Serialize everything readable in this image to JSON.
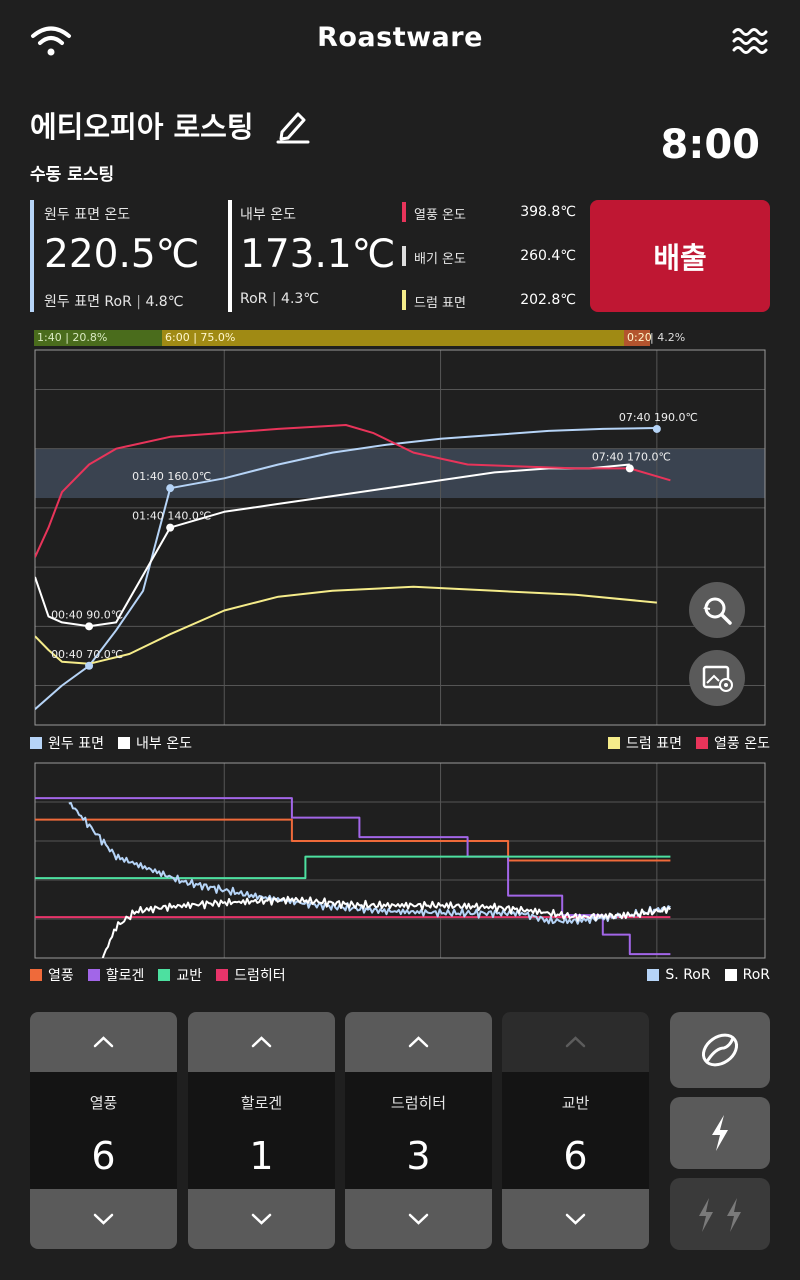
{
  "header": {
    "brand": "Roastware",
    "wifi_icon": "wifi-icon",
    "menu_icon": "wave-menu-icon"
  },
  "roast": {
    "title": "에티오피아 로스팅",
    "mode": "수동 로스팅",
    "elapsed": "8:00"
  },
  "stats": {
    "bean_surface": {
      "label": "원두 표면 온도",
      "value": "220.5℃",
      "ror_label": "원두 표면 RoR",
      "ror_value": "4.8℃"
    },
    "inner": {
      "label": "내부 온도",
      "value": "173.1℃",
      "ror_label": "RoR",
      "ror_value": "4.3℃"
    },
    "hot_air": {
      "label": "열풍 온도",
      "value": "398.8℃",
      "color": "#e8345a"
    },
    "exhaust": {
      "label": "배기 온도",
      "value": "260.4℃",
      "color": "#dddddd"
    },
    "drum": {
      "label": "드럼 표면",
      "value": "202.8℃",
      "color": "#f5ec8a"
    }
  },
  "discharge_button": "배출",
  "phases": [
    {
      "label": "1:40 | 20.8%",
      "fraction": 0.208,
      "color": "#4a6c1c"
    },
    {
      "label": "6:00 | 75.0%",
      "fraction": 0.75,
      "color": "#a08a14"
    },
    {
      "label": "0:20",
      "fraction": 0.042,
      "color": "#b3542e"
    }
  ],
  "phase_extra": "| 4.2%",
  "chart_data": [
    {
      "type": "line",
      "x_unit": "seconds",
      "xlim": [
        0,
        540
      ],
      "ylim": [
        40,
        230
      ],
      "band": [
        155,
        180
      ],
      "grid": true,
      "series": [
        {
          "name": "원두 표면",
          "color": "#b6d4f7",
          "points": [
            [
              0,
              48
            ],
            [
              20,
              60
            ],
            [
              40,
              70
            ],
            [
              60,
              88
            ],
            [
              80,
              108
            ],
            [
              100,
              160
            ],
            [
              140,
              165
            ],
            [
              180,
              172
            ],
            [
              220,
              178
            ],
            [
              260,
              182
            ],
            [
              300,
              185
            ],
            [
              340,
              187
            ],
            [
              380,
              189
            ],
            [
              420,
              190
            ],
            [
              460,
              190.5
            ]
          ]
        },
        {
          "name": "내부 온도",
          "color": "#ffffff",
          "points": [
            [
              0,
              115
            ],
            [
              10,
              95
            ],
            [
              20,
              92
            ],
            [
              40,
              90
            ],
            [
              60,
              92
            ],
            [
              100,
              140
            ],
            [
              140,
              148
            ],
            [
              180,
              152
            ],
            [
              220,
              156
            ],
            [
              260,
              160
            ],
            [
              300,
              164
            ],
            [
              340,
              168
            ],
            [
              380,
              170
            ],
            [
              410,
              170
            ],
            [
              440,
              172
            ]
          ]
        },
        {
          "name": "드럼 표면",
          "color": "#f5ec8a",
          "points": [
            [
              0,
              85
            ],
            [
              10,
              78
            ],
            [
              20,
              72
            ],
            [
              40,
              71
            ],
            [
              70,
              76
            ],
            [
              100,
              86
            ],
            [
              140,
              98
            ],
            [
              180,
              105
            ],
            [
              220,
              108
            ],
            [
              280,
              110
            ],
            [
              340,
              108
            ],
            [
              400,
              106
            ],
            [
              460,
              102
            ]
          ]
        },
        {
          "name": "열풍 온도",
          "color": "#e8345a",
          "points": [
            [
              0,
              125
            ],
            [
              10,
              140
            ],
            [
              20,
              158
            ],
            [
              40,
              172
            ],
            [
              60,
              180
            ],
            [
              100,
              186
            ],
            [
              140,
              188
            ],
            [
              180,
              190
            ],
            [
              230,
              192
            ],
            [
              250,
              188
            ],
            [
              280,
              178
            ],
            [
              320,
              172
            ],
            [
              400,
              170
            ],
            [
              440,
              170
            ],
            [
              470,
              164
            ]
          ]
        }
      ],
      "annotations": [
        {
          "series": "원두 표면",
          "x": 40,
          "y": 70,
          "label": "00:40 70.0℃"
        },
        {
          "series": "내부 온도",
          "x": 40,
          "y": 90,
          "label": "00:40 90.0℃"
        },
        {
          "series": "원두 표면",
          "x": 100,
          "y": 160,
          "label": "01:40 160.0℃"
        },
        {
          "series": "내부 온도",
          "x": 100,
          "y": 140,
          "label": "01:40 140.0℃"
        },
        {
          "series": "원두 표면",
          "x": 460,
          "y": 190,
          "label": "07:40 190.0℃"
        },
        {
          "series": "내부 온도",
          "x": 440,
          "y": 170,
          "label": "07:40 170.0℃"
        }
      ]
    },
    {
      "type": "line",
      "x_unit": "seconds",
      "xlim": [
        0,
        540
      ],
      "ylim": [
        0,
        10
      ],
      "grid": true,
      "series": [
        {
          "name": "열풍",
          "color": "#ef6a3a",
          "step": true,
          "points": [
            [
              0,
              7.1
            ],
            [
              190,
              6.0
            ],
            [
              340,
              6.0
            ],
            [
              350,
              5.0
            ],
            [
              470,
              5.0
            ]
          ]
        },
        {
          "name": "할로겐",
          "color": "#a266e8",
          "step": true,
          "points": [
            [
              0,
              8.2
            ],
            [
              190,
              7.2
            ],
            [
              240,
              6.2
            ],
            [
              320,
              5.2
            ],
            [
              350,
              3.2
            ],
            [
              390,
              2.2
            ],
            [
              420,
              1.2
            ],
            [
              440,
              0.2
            ],
            [
              470,
              0.2
            ]
          ]
        },
        {
          "name": "교반",
          "color": "#4de0a0",
          "step": true,
          "points": [
            [
              0,
              4.1
            ],
            [
              200,
              5.2
            ],
            [
              470,
              5.2
            ]
          ]
        },
        {
          "name": "드럼히터",
          "color": "#e8346a",
          "step": true,
          "points": [
            [
              0,
              2.1
            ],
            [
              470,
              2.1
            ]
          ]
        },
        {
          "name": "S. RoR",
          "color": "#b6d4f7",
          "noise": true,
          "points": [
            [
              25,
              8.0
            ],
            [
              60,
              5.2
            ],
            [
              110,
              3.9
            ],
            [
              160,
              3.2
            ],
            [
              210,
              2.7
            ],
            [
              260,
              2.4
            ],
            [
              310,
              2.3
            ],
            [
              360,
              2.3
            ],
            [
              380,
              1.9
            ],
            [
              400,
              1.9
            ],
            [
              440,
              2.2
            ],
            [
              470,
              2.6
            ]
          ]
        },
        {
          "name": "RoR",
          "color": "#ffffff",
          "noise": true,
          "points": [
            [
              45,
              -0.8
            ],
            [
              60,
              1.6
            ],
            [
              75,
              2.4
            ],
            [
              95,
              2.6
            ],
            [
              130,
              2.8
            ],
            [
              190,
              3.0
            ],
            [
              240,
              2.7
            ],
            [
              300,
              2.7
            ],
            [
              340,
              2.6
            ],
            [
              370,
              2.4
            ],
            [
              400,
              2.1
            ],
            [
              440,
              2.2
            ],
            [
              470,
              2.5
            ]
          ]
        }
      ]
    }
  ],
  "legend_top": {
    "left": [
      {
        "label": "원두 표면",
        "color": "#b6d4f7"
      },
      {
        "label": "내부 온도",
        "color": "#ffffff"
      }
    ],
    "right": [
      {
        "label": "드럼 표면",
        "color": "#f5ec8a"
      },
      {
        "label": "열풍 온도",
        "color": "#e8345a"
      }
    ]
  },
  "legend_bottom": {
    "left": [
      {
        "label": "열풍",
        "color": "#ef6a3a"
      },
      {
        "label": "할로겐",
        "color": "#a266e8"
      },
      {
        "label": "교반",
        "color": "#4de0a0"
      },
      {
        "label": "드럼히터",
        "color": "#e8346a"
      }
    ],
    "right": [
      {
        "label": "S. RoR",
        "color": "#b6d4f7"
      },
      {
        "label": "RoR",
        "color": "#ffffff"
      }
    ]
  },
  "controls": [
    {
      "label": "열풍",
      "value": "6",
      "up_enabled": true
    },
    {
      "label": "할로겐",
      "value": "1",
      "up_enabled": true
    },
    {
      "label": "드럼히터",
      "value": "3",
      "up_enabled": true
    },
    {
      "label": "교반",
      "value": "6",
      "up_enabled": false
    }
  ],
  "side_buttons": [
    "coffee-bean-icon",
    "lightning-icon",
    "double-lightning-icon"
  ]
}
